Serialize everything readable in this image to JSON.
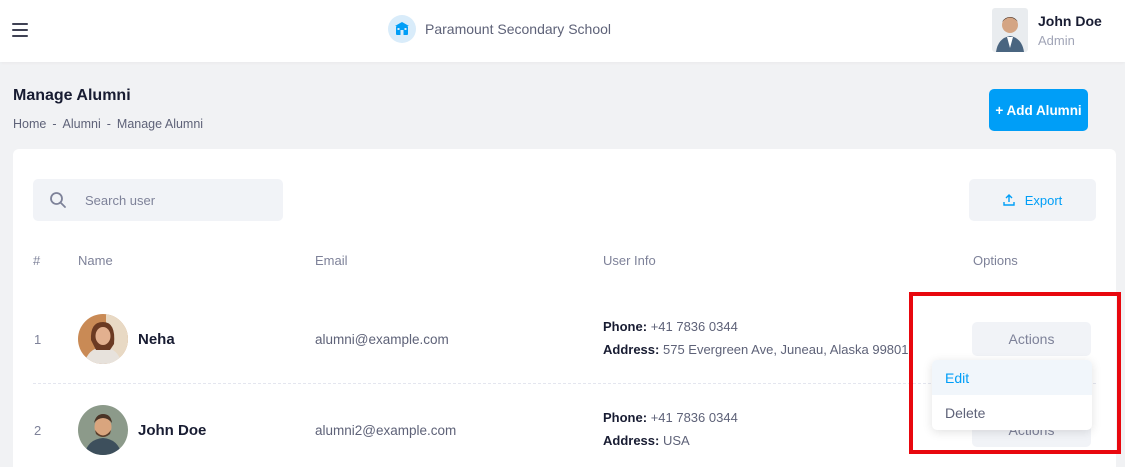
{
  "topbar": {
    "school_name": "Paramount Secondary School",
    "user_name": "John Doe",
    "user_role": "Admin"
  },
  "page": {
    "title": "Manage Alumni",
    "breadcrumb": [
      "Home",
      "Alumni",
      "Manage Alumni"
    ],
    "breadcrumb_sep": "-",
    "add_button": "+ Add Alumni"
  },
  "toolbar": {
    "search_placeholder": "Search user",
    "export_label": "Export"
  },
  "table": {
    "headers": [
      "#",
      "Name",
      "Email",
      "User Info",
      "Options"
    ],
    "rows": [
      {
        "index": "1",
        "name": "Neha",
        "email": "alumni@example.com",
        "phone_label": "Phone:",
        "phone": "+41 7836 0344",
        "address_label": "Address:",
        "address": "575 Evergreen Ave, Juneau, Alaska 99801",
        "actions_label": "Actions"
      },
      {
        "index": "2",
        "name": "John Doe",
        "email": "alumni2@example.com",
        "phone_label": "Phone:",
        "phone": "+41 7836 0344",
        "address_label": "Address:",
        "address": "USA",
        "actions_label": "Actions"
      }
    ]
  },
  "dropdown": {
    "items": [
      "Edit",
      "Delete"
    ]
  },
  "colors": {
    "primary": "#009ef7",
    "highlight": "#e8070e"
  }
}
